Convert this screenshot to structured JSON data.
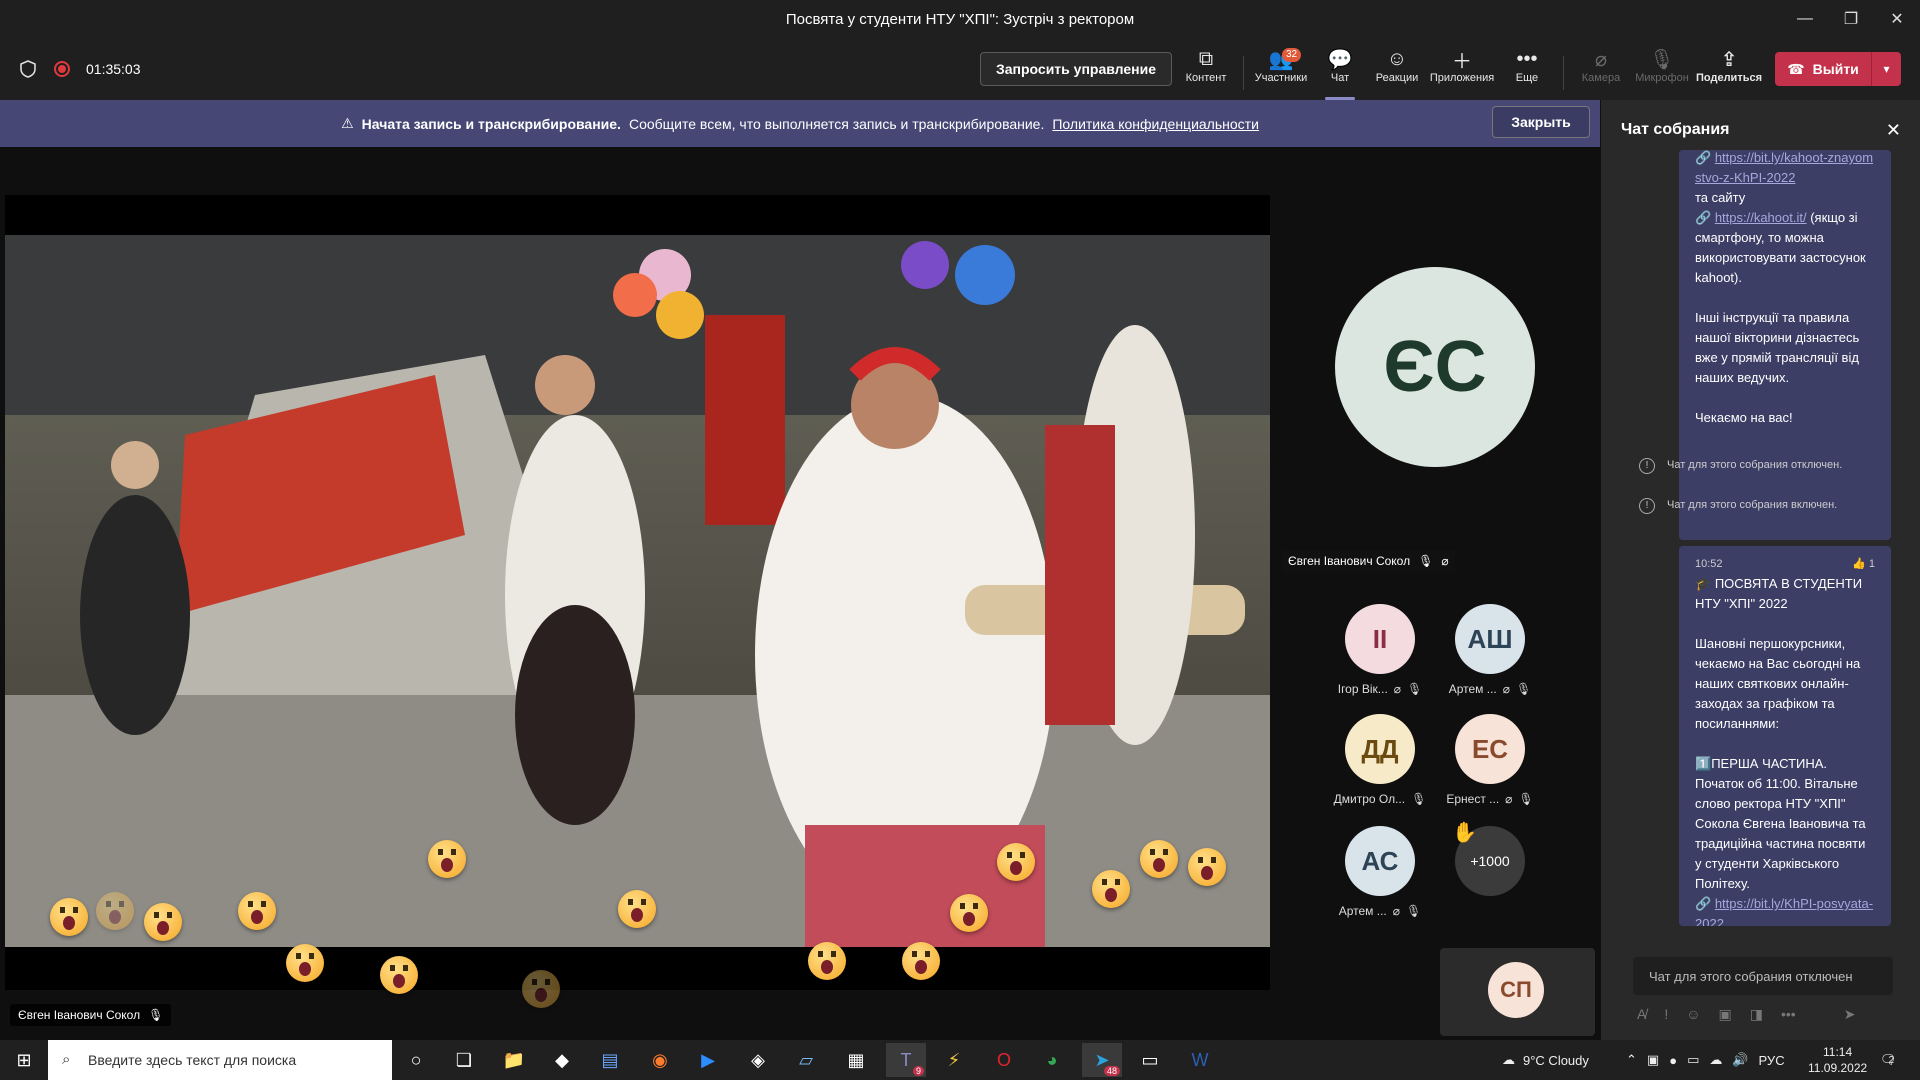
{
  "window": {
    "title": "Посвята у студенти НТУ \"ХПІ\": Зустріч з ректором"
  },
  "toolbar": {
    "timer": "01:35:03",
    "request_control": "Запросить управление",
    "buttons": [
      {
        "label": "Контент",
        "icon": "share-screen-icon"
      },
      {
        "label": "Участники",
        "icon": "people-icon",
        "badge": "32"
      },
      {
        "label": "Чат",
        "icon": "chat-icon"
      },
      {
        "label": "Реакции",
        "icon": "reactions-icon"
      },
      {
        "label": "Приложения",
        "icon": "plus-icon"
      },
      {
        "label": "Еще",
        "icon": "more-icon"
      },
      {
        "label": "Камера",
        "icon": "camera-off-icon"
      },
      {
        "label": "Микрофон",
        "icon": "mic-off-icon"
      },
      {
        "label": "Поделиться",
        "icon": "share-icon"
      }
    ],
    "leave": "Выйти"
  },
  "banner": {
    "bold": "Начата запись и транскрибирование.",
    "text": "Сообщите всем, что выполняется запись и транскрибирование.",
    "link": "Политика конфиденциальности",
    "close": "Закрыть"
  },
  "stage": {
    "speaker_name": "Євген Іванович Сокол",
    "featured": {
      "initials": "ЄС",
      "name": "Євген Іванович Сокол"
    },
    "participants": [
      {
        "initials": "ІІ",
        "name": "Ігор Вік...",
        "bg": "#f3dbe0",
        "fg": "#8a2d45"
      },
      {
        "initials": "АШ",
        "name": "Артем ...",
        "bg": "#d9e3ea",
        "fg": "#2d4456"
      },
      {
        "initials": "ДД",
        "name": "Дмитро Ол...",
        "bg": "#f7eac8",
        "fg": "#6a4a10"
      },
      {
        "initials": "ЕС",
        "name": "Ернест ...",
        "bg": "#f8e3d9",
        "fg": "#8a4a2d"
      },
      {
        "initials": "АС",
        "name": "Артем ...",
        "bg": "#d9e3ea",
        "fg": "#2d4456"
      }
    ],
    "overflow": "+1000",
    "self_initials": "СП"
  },
  "chat": {
    "title": "Чат собрания",
    "msg1": {
      "link1": "https://bit.ly/kahoot-znayomstvo-z-KhPI-2022",
      "line_site": "та сайту",
      "link2": "https://kahoot.it/",
      "after_link2": "(якщо зі смартфону, то можна використовувати застосунок kahoot).",
      "para2": "Інші інструкції та правила нашої вікторини дізнаєтесь вже у прямій трансляції від наших ведучих.",
      "para3": "Чекаємо на вас!"
    },
    "sys1": "Чат для этого собрания отключен.",
    "sys2": "Чат для этого собрания включен.",
    "msg2": {
      "time": "10:52",
      "reaction": "1",
      "title": "ПОСВЯТА В СТУДЕНТИ НТУ \"ХПІ\" 2022",
      "para1": "Шановні першокурсники, чекаємо на Вас сьогодні на наших святкових онлайн-заходах за графіком та посиланнями:",
      "para2": "ПЕРША ЧАСТИНА. Початок об 11:00. Вітальне слово ректора НТУ \"ХПІ\" Сокола Євгена Івановича та традиційна частина посвяти у студенти Харківського Політеху.",
      "link": "https://bit.ly/KhPI-posvyata-2022"
    },
    "input_placeholder": "Чат для этого собрания отключен"
  },
  "taskbar": {
    "search_placeholder": "Введите здесь текст для поиска",
    "weather": "9°C  Cloudy",
    "lang": "РУС",
    "time": "11:14",
    "date": "11.09.2022",
    "notif_count": "2",
    "teams_badge": "9",
    "telegram_badge": "48"
  }
}
